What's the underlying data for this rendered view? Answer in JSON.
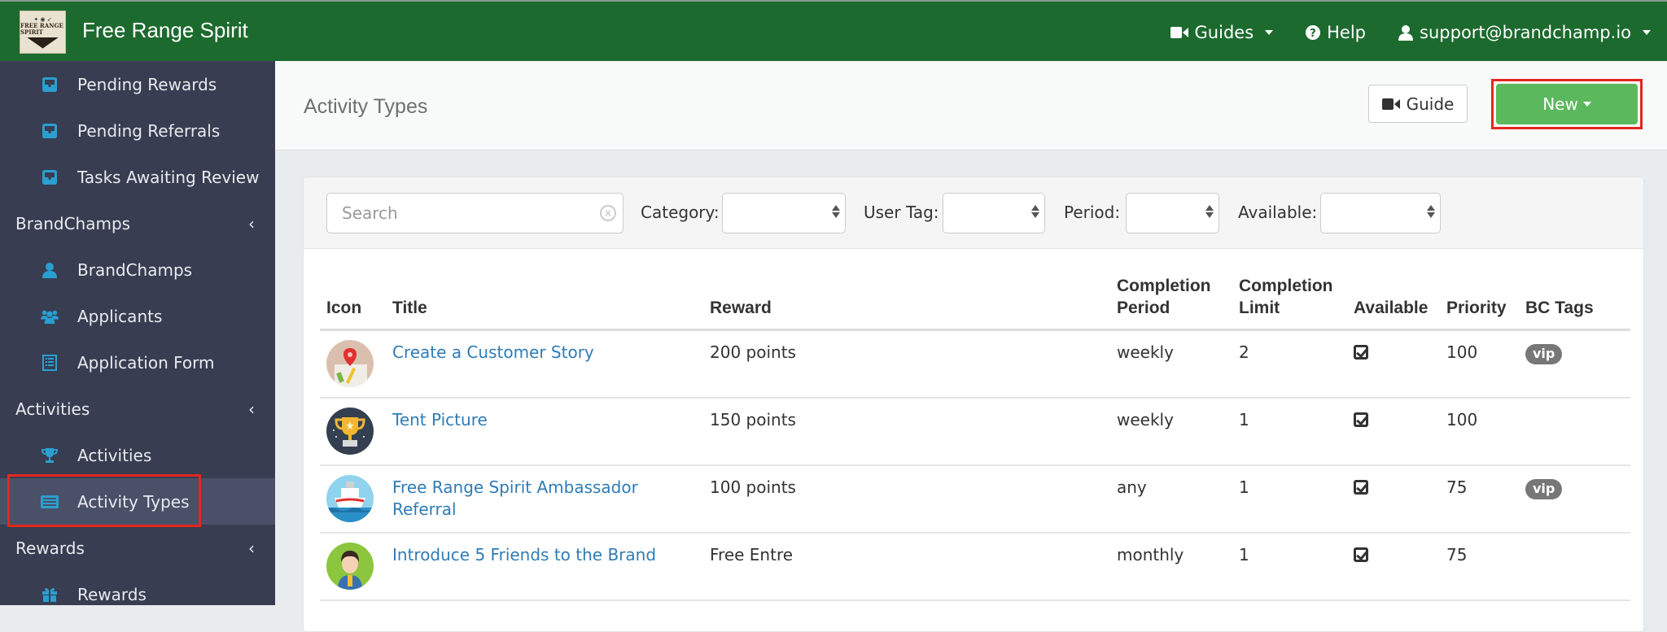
{
  "app": {
    "brand": "Free Range Spirit",
    "logo_text": "FREE RANGE SPIRIT",
    "accent_color": "#1c6a2e"
  },
  "topnav": {
    "guides": {
      "label": "Guides",
      "icon": "video-camera-icon"
    },
    "help": {
      "label": "Help",
      "icon": "question-circle-icon"
    },
    "user": {
      "label": "support@brandchamp.io",
      "icon": "user-icon"
    }
  },
  "sidebar": {
    "items": [
      {
        "label": "Pending Rewards",
        "icon": "inbox-icon",
        "type": "sub"
      },
      {
        "label": "Pending Referrals",
        "icon": "inbox-icon",
        "type": "sub"
      },
      {
        "label": "Tasks Awaiting Review",
        "icon": "inbox-icon",
        "type": "sub"
      },
      {
        "label": "BrandChamps",
        "type": "section"
      },
      {
        "label": "BrandChamps",
        "icon": "user-icon",
        "type": "sub"
      },
      {
        "label": "Applicants",
        "icon": "users-icon",
        "type": "sub"
      },
      {
        "label": "Application Form",
        "icon": "list-alt-icon",
        "type": "sub"
      },
      {
        "label": "Activities",
        "type": "section"
      },
      {
        "label": "Activities",
        "icon": "trophy-icon",
        "type": "sub"
      },
      {
        "label": "Activity Types",
        "icon": "keyboard-icon",
        "type": "sub",
        "active": true
      },
      {
        "label": "Rewards",
        "type": "section"
      },
      {
        "label": "Rewards",
        "icon": "gift-icon",
        "type": "sub"
      }
    ],
    "chevron": "‹"
  },
  "page": {
    "title": "Activity Types",
    "guide_button": "Guide",
    "new_button": "New"
  },
  "filters": {
    "search_placeholder": "Search",
    "search_value": "",
    "category_label": "Category:",
    "category_value": "",
    "user_tag_label": "User Tag:",
    "user_tag_value": "",
    "period_label": "Period:",
    "period_value": "",
    "available_label": "Available:",
    "available_value": ""
  },
  "table": {
    "headers": {
      "icon": "Icon",
      "title": "Title",
      "reward": "Reward",
      "completion_period_1": "Completion",
      "completion_period_2": "Period",
      "completion_limit_1": "Completion",
      "completion_limit_2": "Limit",
      "available": "Available",
      "priority": "Priority",
      "bc_tags": "BC Tags"
    },
    "rows": [
      {
        "icon": "map-pin-avatar",
        "title": "Create a Customer Story",
        "reward": "200 points",
        "period": "weekly",
        "limit": "2",
        "available": true,
        "priority": "100",
        "tag": "vip"
      },
      {
        "icon": "trophy-avatar",
        "title": "Tent Picture",
        "reward": "150 points",
        "period": "weekly",
        "limit": "1",
        "available": true,
        "priority": "100",
        "tag": ""
      },
      {
        "icon": "ship-avatar",
        "title": "Free Range Spirit Ambassador Referral",
        "reward": "100 points",
        "period": "any",
        "limit": "1",
        "available": true,
        "priority": "75",
        "tag": "vip"
      },
      {
        "icon": "person-avatar",
        "title": "Introduce 5 Friends to the Brand",
        "reward": "Free Entre",
        "period": "monthly",
        "limit": "1",
        "available": true,
        "priority": "75",
        "tag": ""
      }
    ]
  }
}
